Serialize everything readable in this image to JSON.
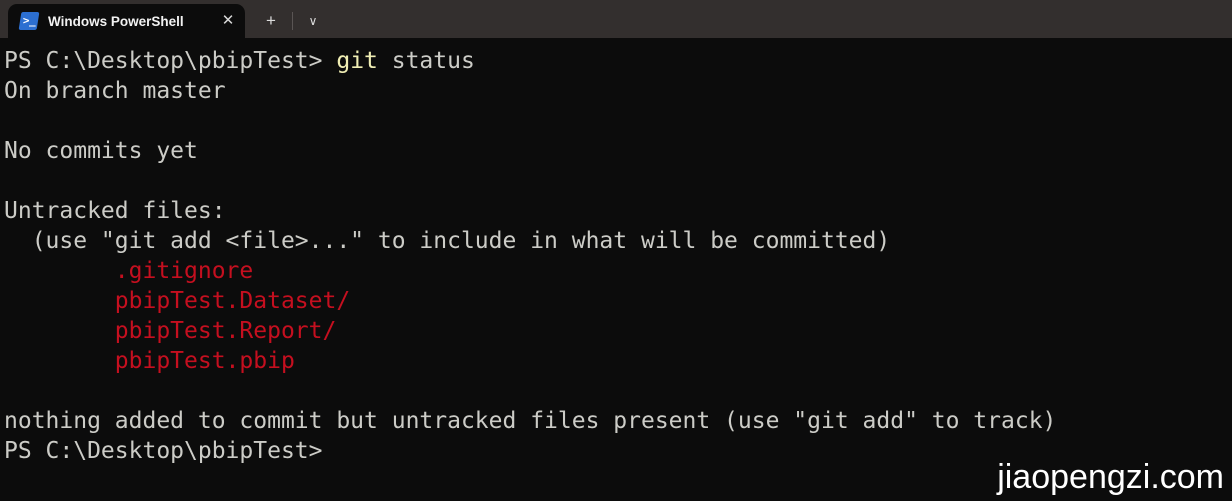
{
  "window": {
    "title": "Windows PowerShell",
    "colors": {
      "titlebar_bg": "#332f2e",
      "terminal_bg": "#0c0c0c",
      "foreground": "#ccccc7",
      "yellow": "#f0eeb4",
      "red": "#c50f1f",
      "tab_icon_blue": "#2c6fd1"
    }
  },
  "tabbar": {
    "tab_label": "Windows PowerShell",
    "tab_icon": "powershell-icon",
    "tab_icon_glyph": ">_",
    "close_label": "✕",
    "new_tab_label": "+",
    "dropdown_label": "∨"
  },
  "terminal": {
    "lines": [
      {
        "id": "prompt-command",
        "segments": [
          {
            "text": "PS C:\\Desktop\\pbipTest> ",
            "color": "default"
          },
          {
            "text": "git",
            "color": "yellow"
          },
          {
            "text": " status",
            "color": "default"
          }
        ]
      },
      {
        "id": "branch-line",
        "segments": [
          {
            "text": "On branch master",
            "color": "default"
          }
        ]
      },
      {
        "id": "blank-1",
        "segments": [
          {
            "text": "",
            "color": "default"
          }
        ]
      },
      {
        "id": "no-commits-line",
        "segments": [
          {
            "text": "No commits yet",
            "color": "default"
          }
        ]
      },
      {
        "id": "blank-2",
        "segments": [
          {
            "text": "",
            "color": "default"
          }
        ]
      },
      {
        "id": "untracked-header",
        "segments": [
          {
            "text": "Untracked files:",
            "color": "default"
          }
        ]
      },
      {
        "id": "untracked-hint",
        "segments": [
          {
            "text": "  (use \"git add <file>...\" to include in what will be committed)",
            "color": "default"
          }
        ]
      },
      {
        "id": "untracked-file-1",
        "segments": [
          {
            "text": "        .gitignore",
            "color": "red"
          }
        ]
      },
      {
        "id": "untracked-file-2",
        "segments": [
          {
            "text": "        pbipTest.Dataset/",
            "color": "red"
          }
        ]
      },
      {
        "id": "untracked-file-3",
        "segments": [
          {
            "text": "        pbipTest.Report/",
            "color": "red"
          }
        ]
      },
      {
        "id": "untracked-file-4",
        "segments": [
          {
            "text": "        pbipTest.pbip",
            "color": "red"
          }
        ]
      },
      {
        "id": "blank-3",
        "segments": [
          {
            "text": "",
            "color": "default"
          }
        ]
      },
      {
        "id": "summary-line",
        "segments": [
          {
            "text": "nothing added to commit but untracked files present (use \"git add\" to track)",
            "color": "default"
          }
        ]
      },
      {
        "id": "final-prompt",
        "segments": [
          {
            "text": "PS C:\\Desktop\\pbipTest>",
            "color": "default"
          }
        ]
      }
    ]
  },
  "watermark": {
    "text": "jiaopengzi.com"
  }
}
